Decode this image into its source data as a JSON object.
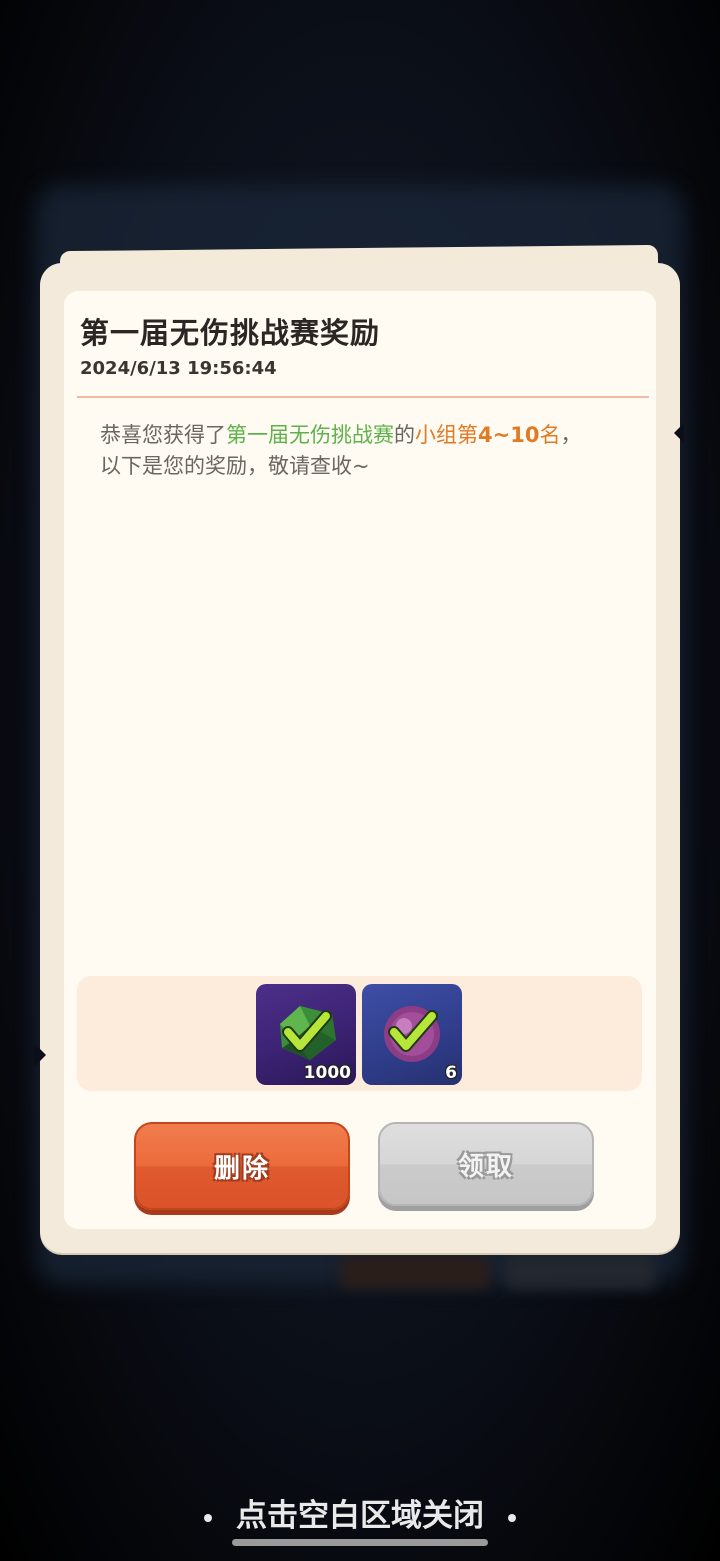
{
  "mail": {
    "title": "第一届无伤挑战赛奖励",
    "datetime": "2024/6/13 19:56:44",
    "body": {
      "prefix": "恭喜您获得了",
      "event_name": "第一届无伤挑战赛",
      "connector": "的",
      "rank_label": "小组第",
      "rank_value": "4~10",
      "rank_suffix": "名",
      "tail_comma": "，",
      "line2": "以下是您的奖励，敬请查收~"
    },
    "rewards": [
      {
        "icon": "green-gem-icon",
        "quantity": "1000",
        "claimed": true
      },
      {
        "icon": "purple-orb-icon",
        "quantity": "6",
        "claimed": true
      }
    ],
    "buttons": {
      "delete_label": "删除",
      "claim_label": "领取"
    },
    "colors": {
      "highlight_green": "#5db34a",
      "highlight_orange": "#e07a24",
      "delete_button": "#ec6a3b",
      "claim_button_disabled": "#d6d6d6"
    }
  },
  "close_hint": "点击空白区域关闭"
}
